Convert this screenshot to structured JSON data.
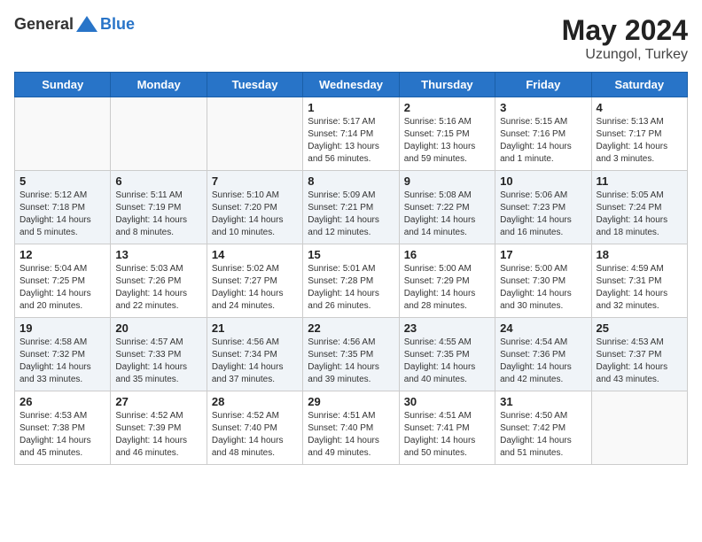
{
  "header": {
    "logo_general": "General",
    "logo_blue": "Blue",
    "title": "May 2024",
    "subtitle": "Uzungol, Turkey"
  },
  "weekdays": [
    "Sunday",
    "Monday",
    "Tuesday",
    "Wednesday",
    "Thursday",
    "Friday",
    "Saturday"
  ],
  "weeks": [
    [
      {
        "day": "",
        "info": ""
      },
      {
        "day": "",
        "info": ""
      },
      {
        "day": "",
        "info": ""
      },
      {
        "day": "1",
        "info": "Sunrise: 5:17 AM\nSunset: 7:14 PM\nDaylight: 13 hours\nand 56 minutes."
      },
      {
        "day": "2",
        "info": "Sunrise: 5:16 AM\nSunset: 7:15 PM\nDaylight: 13 hours\nand 59 minutes."
      },
      {
        "day": "3",
        "info": "Sunrise: 5:15 AM\nSunset: 7:16 PM\nDaylight: 14 hours\nand 1 minute."
      },
      {
        "day": "4",
        "info": "Sunrise: 5:13 AM\nSunset: 7:17 PM\nDaylight: 14 hours\nand 3 minutes."
      }
    ],
    [
      {
        "day": "5",
        "info": "Sunrise: 5:12 AM\nSunset: 7:18 PM\nDaylight: 14 hours\nand 5 minutes."
      },
      {
        "day": "6",
        "info": "Sunrise: 5:11 AM\nSunset: 7:19 PM\nDaylight: 14 hours\nand 8 minutes."
      },
      {
        "day": "7",
        "info": "Sunrise: 5:10 AM\nSunset: 7:20 PM\nDaylight: 14 hours\nand 10 minutes."
      },
      {
        "day": "8",
        "info": "Sunrise: 5:09 AM\nSunset: 7:21 PM\nDaylight: 14 hours\nand 12 minutes."
      },
      {
        "day": "9",
        "info": "Sunrise: 5:08 AM\nSunset: 7:22 PM\nDaylight: 14 hours\nand 14 minutes."
      },
      {
        "day": "10",
        "info": "Sunrise: 5:06 AM\nSunset: 7:23 PM\nDaylight: 14 hours\nand 16 minutes."
      },
      {
        "day": "11",
        "info": "Sunrise: 5:05 AM\nSunset: 7:24 PM\nDaylight: 14 hours\nand 18 minutes."
      }
    ],
    [
      {
        "day": "12",
        "info": "Sunrise: 5:04 AM\nSunset: 7:25 PM\nDaylight: 14 hours\nand 20 minutes."
      },
      {
        "day": "13",
        "info": "Sunrise: 5:03 AM\nSunset: 7:26 PM\nDaylight: 14 hours\nand 22 minutes."
      },
      {
        "day": "14",
        "info": "Sunrise: 5:02 AM\nSunset: 7:27 PM\nDaylight: 14 hours\nand 24 minutes."
      },
      {
        "day": "15",
        "info": "Sunrise: 5:01 AM\nSunset: 7:28 PM\nDaylight: 14 hours\nand 26 minutes."
      },
      {
        "day": "16",
        "info": "Sunrise: 5:00 AM\nSunset: 7:29 PM\nDaylight: 14 hours\nand 28 minutes."
      },
      {
        "day": "17",
        "info": "Sunrise: 5:00 AM\nSunset: 7:30 PM\nDaylight: 14 hours\nand 30 minutes."
      },
      {
        "day": "18",
        "info": "Sunrise: 4:59 AM\nSunset: 7:31 PM\nDaylight: 14 hours\nand 32 minutes."
      }
    ],
    [
      {
        "day": "19",
        "info": "Sunrise: 4:58 AM\nSunset: 7:32 PM\nDaylight: 14 hours\nand 33 minutes."
      },
      {
        "day": "20",
        "info": "Sunrise: 4:57 AM\nSunset: 7:33 PM\nDaylight: 14 hours\nand 35 minutes."
      },
      {
        "day": "21",
        "info": "Sunrise: 4:56 AM\nSunset: 7:34 PM\nDaylight: 14 hours\nand 37 minutes."
      },
      {
        "day": "22",
        "info": "Sunrise: 4:56 AM\nSunset: 7:35 PM\nDaylight: 14 hours\nand 39 minutes."
      },
      {
        "day": "23",
        "info": "Sunrise: 4:55 AM\nSunset: 7:35 PM\nDaylight: 14 hours\nand 40 minutes."
      },
      {
        "day": "24",
        "info": "Sunrise: 4:54 AM\nSunset: 7:36 PM\nDaylight: 14 hours\nand 42 minutes."
      },
      {
        "day": "25",
        "info": "Sunrise: 4:53 AM\nSunset: 7:37 PM\nDaylight: 14 hours\nand 43 minutes."
      }
    ],
    [
      {
        "day": "26",
        "info": "Sunrise: 4:53 AM\nSunset: 7:38 PM\nDaylight: 14 hours\nand 45 minutes."
      },
      {
        "day": "27",
        "info": "Sunrise: 4:52 AM\nSunset: 7:39 PM\nDaylight: 14 hours\nand 46 minutes."
      },
      {
        "day": "28",
        "info": "Sunrise: 4:52 AM\nSunset: 7:40 PM\nDaylight: 14 hours\nand 48 minutes."
      },
      {
        "day": "29",
        "info": "Sunrise: 4:51 AM\nSunset: 7:40 PM\nDaylight: 14 hours\nand 49 minutes."
      },
      {
        "day": "30",
        "info": "Sunrise: 4:51 AM\nSunset: 7:41 PM\nDaylight: 14 hours\nand 50 minutes."
      },
      {
        "day": "31",
        "info": "Sunrise: 4:50 AM\nSunset: 7:42 PM\nDaylight: 14 hours\nand 51 minutes."
      },
      {
        "day": "",
        "info": ""
      }
    ]
  ]
}
